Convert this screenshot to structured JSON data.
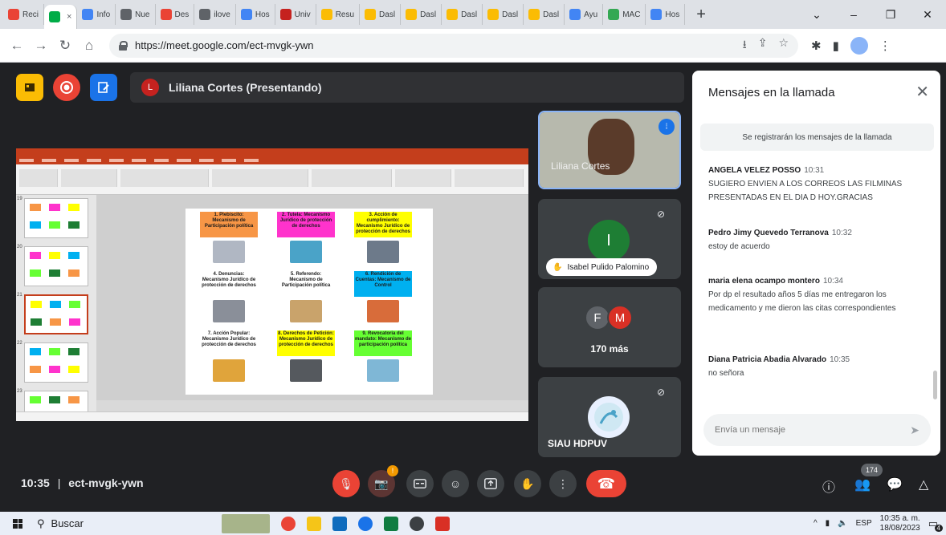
{
  "browser": {
    "tabs": [
      {
        "label": "Reci",
        "color": "#ea4335"
      },
      {
        "label": "",
        "color": "#00ac47",
        "active": true
      },
      {
        "label": "Info",
        "color": "#4285f4"
      },
      {
        "label": "Nue",
        "color": "#5f6368"
      },
      {
        "label": "Des",
        "color": "#ea4335"
      },
      {
        "label": "ilove",
        "color": "#5f6368"
      },
      {
        "label": "Hos",
        "color": "#4285f4"
      },
      {
        "label": "Univ",
        "color": "#c5221f"
      },
      {
        "label": "Resu",
        "color": "#fbbc04"
      },
      {
        "label": "Dasl",
        "color": "#fbbc04"
      },
      {
        "label": "Dasl",
        "color": "#fbbc04"
      },
      {
        "label": "Dasl",
        "color": "#fbbc04"
      },
      {
        "label": "Dasl",
        "color": "#fbbc04"
      },
      {
        "label": "Dasl",
        "color": "#fbbc04"
      },
      {
        "label": "Ayu",
        "color": "#4285f4"
      },
      {
        "label": "MAC",
        "color": "#34a853"
      },
      {
        "label": "Hos",
        "color": "#4285f4"
      }
    ],
    "active_tab_close": "×",
    "new_tab": "+",
    "url": "https://meet.google.com/ect-mvgk-ywn",
    "window_controls": [
      "⌄",
      "–",
      "❐",
      "✕"
    ]
  },
  "meet": {
    "presenter_initial": "L",
    "presenter_label": "Liliana Cortes (Presentando)",
    "presenter_avatar_color": "#c5221f",
    "slide": {
      "boxes": [
        {
          "text": "1. Plebiscito: Mecanismo de Participación política",
          "color": "#f79646"
        },
        {
          "text": "2. Tutela: Mecanismo Jurídico de protección de derechos",
          "color": "#ff33cc"
        },
        {
          "text": "3. Acción de cumplimiento: Mecanismo Jurídico de protección de derechos",
          "color": "#ffff00"
        },
        {
          "text": "4. Denuncias: Mecanismo Jurídico de protección de derechos",
          "color": "#ffffff"
        },
        {
          "text": "5. Referendo: Mecanismo de Participación política",
          "color": "#ffffff"
        },
        {
          "text": "6. Rendición de Cuentas: Mecanismo de Control",
          "color": "#00b0f0"
        },
        {
          "text": "7. Acción Popular: Mecanismo Jurídico de protección de derechos",
          "color": "#ffffff"
        },
        {
          "text": "8. Derechos de Petición: Mecanismo Jurídico de protección de derechos",
          "color": "#ffff00"
        },
        {
          "text": "9. Revocatoria del mandato: Mecanismo de participación política",
          "color": "#66ff33"
        }
      ],
      "thumb_numbers": [
        "19",
        "20",
        "21",
        "22",
        "23"
      ]
    },
    "tiles": {
      "speaker_name": "Liliana Cortes",
      "isabel_initial": "I",
      "isabel_name": "Isabel Pulido Palomino",
      "more_initials": [
        "F",
        "M"
      ],
      "more_count": "170 más",
      "siau_name": "SIAU HDPUV"
    },
    "chat": {
      "title": "Mensajes en la llamada",
      "notice": "Se registrarán los mensajes de la llamada",
      "messages": [
        {
          "sender": "ANGELA VELEZ POSSO",
          "time": "10:31",
          "text": "SUGIERO ENVIEN A LOS CORREOS LAS FILMINAS PRESENTADAS EN EL DIA D HOY.GRACIAS"
        },
        {
          "sender": "Pedro Jimy Quevedo Terranova",
          "time": "10:32",
          "text": "estoy de acuerdo"
        },
        {
          "sender": "maria elena ocampo montero",
          "time": "10:34",
          "text": "Por dp  el resultado  años 5 días me entregaron los medicamento y me dieron las citas correspondientes"
        },
        {
          "sender": "Diana Patricia Abadia Alvarado",
          "time": "10:35",
          "text": "no señora"
        }
      ],
      "input_placeholder": "Envía un mensaje"
    },
    "bottom": {
      "time": "10:35",
      "separator": "|",
      "code": "ect-mvgk-ywn",
      "people_count": "174"
    }
  },
  "taskbar": {
    "search_label": "Buscar",
    "language": "ESP",
    "clock_time": "10:35 a. m.",
    "clock_date": "18/08/2023",
    "notification_count": "4"
  }
}
